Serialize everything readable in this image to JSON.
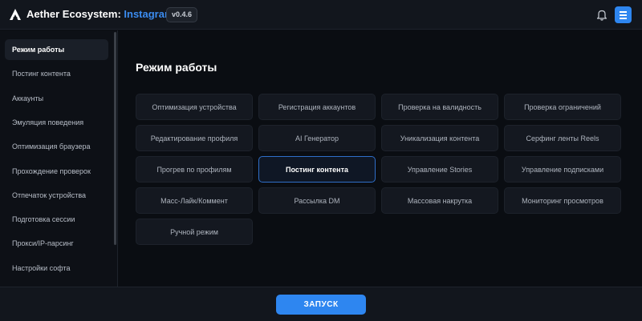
{
  "header": {
    "app_name": "Aether Ecosystem: ",
    "app_module": "Instagram",
    "version": "v0.4.6",
    "icons": [
      "logo-icon",
      "bell-icon",
      "menu-icon"
    ]
  },
  "sidebar": {
    "items": [
      {
        "label": "Режим работы",
        "active": true
      },
      {
        "label": "Постинг контента"
      },
      {
        "label": "Аккаунты"
      },
      {
        "label": "Эмуляция поведения"
      },
      {
        "label": "Оптимизация браузера"
      },
      {
        "label": "Прохождение проверок"
      },
      {
        "label": "Отпечаток устройства"
      },
      {
        "label": "Подготовка сессии"
      },
      {
        "label": "Прокси/IP-парсинг"
      },
      {
        "label": "Настройки софта"
      }
    ]
  },
  "main": {
    "title": "Режим работы",
    "modes": [
      "Оптимизация устройства",
      "Регистрация аккаунтов",
      "Проверка на валидность",
      "Проверка ограничений",
      "Редактирование профиля",
      "AI Генератор",
      "Уникализация контента",
      "Серфинг ленты Reels",
      "Прогрев по профилям",
      "Постинг контента",
      "Управление Stories",
      "Управление подписками",
      "Масс-Лайк/Коммент",
      "Рассылка DM",
      "Массовая накрутка",
      "Мониторинг просмотров",
      "Ручной режим"
    ],
    "active_mode": "Постинг контента"
  },
  "footer": {
    "launch_label": "ЗАПУСК"
  },
  "colors": {
    "accent": "#2e86f0",
    "background": "#0a0d12"
  }
}
